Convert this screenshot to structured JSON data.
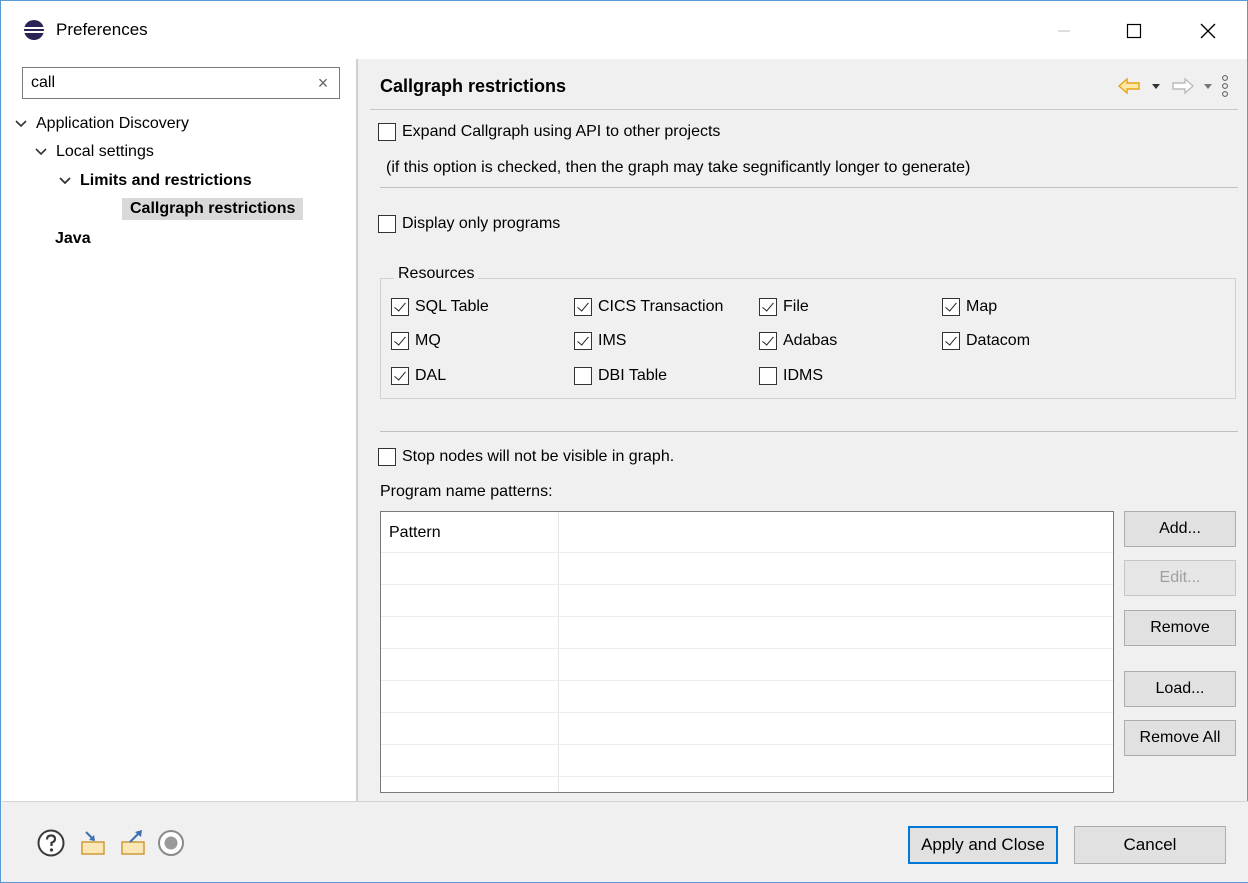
{
  "window": {
    "title": "Preferences",
    "controls": {
      "minimize": "—",
      "maximize": "☐",
      "close": "✕"
    }
  },
  "filter": {
    "value": "call",
    "clear_glyph": "×"
  },
  "tree": [
    {
      "label": "Application Discovery",
      "level": 0,
      "expanded": true,
      "bold": false
    },
    {
      "label": "Local settings",
      "level": 1,
      "expanded": true,
      "bold": false
    },
    {
      "label": "Limits and restrictions",
      "level": 2,
      "expanded": true,
      "bold": true
    },
    {
      "label": "Callgraph restrictions",
      "level": 3,
      "selected": true,
      "bold": true
    },
    {
      "label": "Java",
      "level": 0,
      "bold": true
    }
  ],
  "page": {
    "title": "Callgraph restrictions",
    "nav_icons": [
      "back-arrow-icon",
      "forward-arrow-icon",
      "view-menu-icon"
    ],
    "expand_api": {
      "label": "Expand Callgraph using API to other projects",
      "checked": false
    },
    "expand_note": "(if this option is checked, then the graph may take segnificantly longer to generate)",
    "display_only_programs": {
      "label": "Display only programs",
      "checked": false
    },
    "resources": {
      "legend": "Resources",
      "items": [
        {
          "label": "SQL Table",
          "checked": true
        },
        {
          "label": "CICS Transaction",
          "checked": true
        },
        {
          "label": "File",
          "checked": true
        },
        {
          "label": "Map",
          "checked": true
        },
        {
          "label": "MQ",
          "checked": true
        },
        {
          "label": "IMS",
          "checked": true
        },
        {
          "label": "Adabas",
          "checked": true
        },
        {
          "label": "Datacom",
          "checked": true
        },
        {
          "label": "DAL",
          "checked": true
        },
        {
          "label": "DBI Table",
          "checked": false
        },
        {
          "label": "IDMS",
          "checked": false
        }
      ]
    },
    "stop_nodes": {
      "label": "Stop nodes will not be visible in graph.",
      "checked": false
    },
    "patterns_label": "Program name patterns:",
    "table": {
      "column": "Pattern",
      "rows": []
    },
    "buttons": {
      "add": "Add...",
      "edit": "Edit...",
      "remove": "Remove",
      "load": "Load...",
      "remove_all": "Remove All"
    }
  },
  "footer": {
    "icons": [
      "help-icon",
      "import-icon",
      "export-icon",
      "record-icon"
    ],
    "apply_close": "Apply and Close",
    "cancel": "Cancel"
  },
  "colors": {
    "accent": "#0078d7",
    "nav_arrow": "#e8a317",
    "selection": "#d9d9d9"
  }
}
